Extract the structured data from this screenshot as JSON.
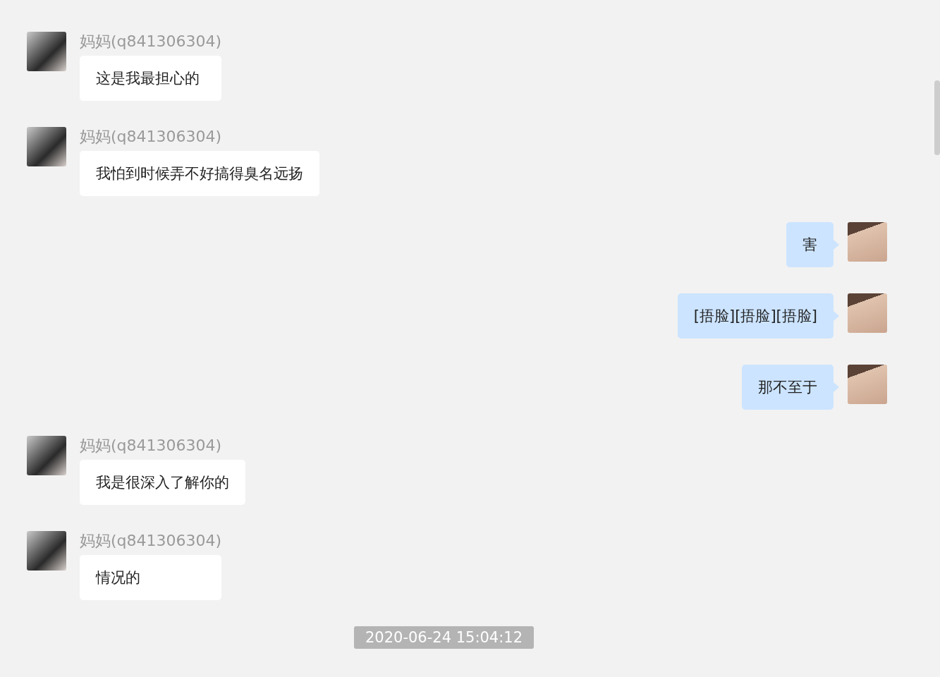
{
  "messages": [
    {
      "kind": "incoming",
      "sender": "妈妈(q841306304)",
      "text": "这是我最担心的"
    },
    {
      "kind": "incoming",
      "sender": "妈妈(q841306304)",
      "text": "我怕到时候弄不好搞得臭名远扬"
    },
    {
      "kind": "outgoing",
      "text": "害"
    },
    {
      "kind": "outgoing",
      "text": "[捂脸][捂脸][捂脸]"
    },
    {
      "kind": "outgoing",
      "text": "那不至于"
    },
    {
      "kind": "incoming",
      "sender": "妈妈(q841306304)",
      "text": "我是很深入了解你的"
    },
    {
      "kind": "incoming",
      "sender": "妈妈(q841306304)",
      "text": "情况的"
    },
    {
      "kind": "timestamp",
      "text": "2020-06-24 15:04:12"
    }
  ]
}
